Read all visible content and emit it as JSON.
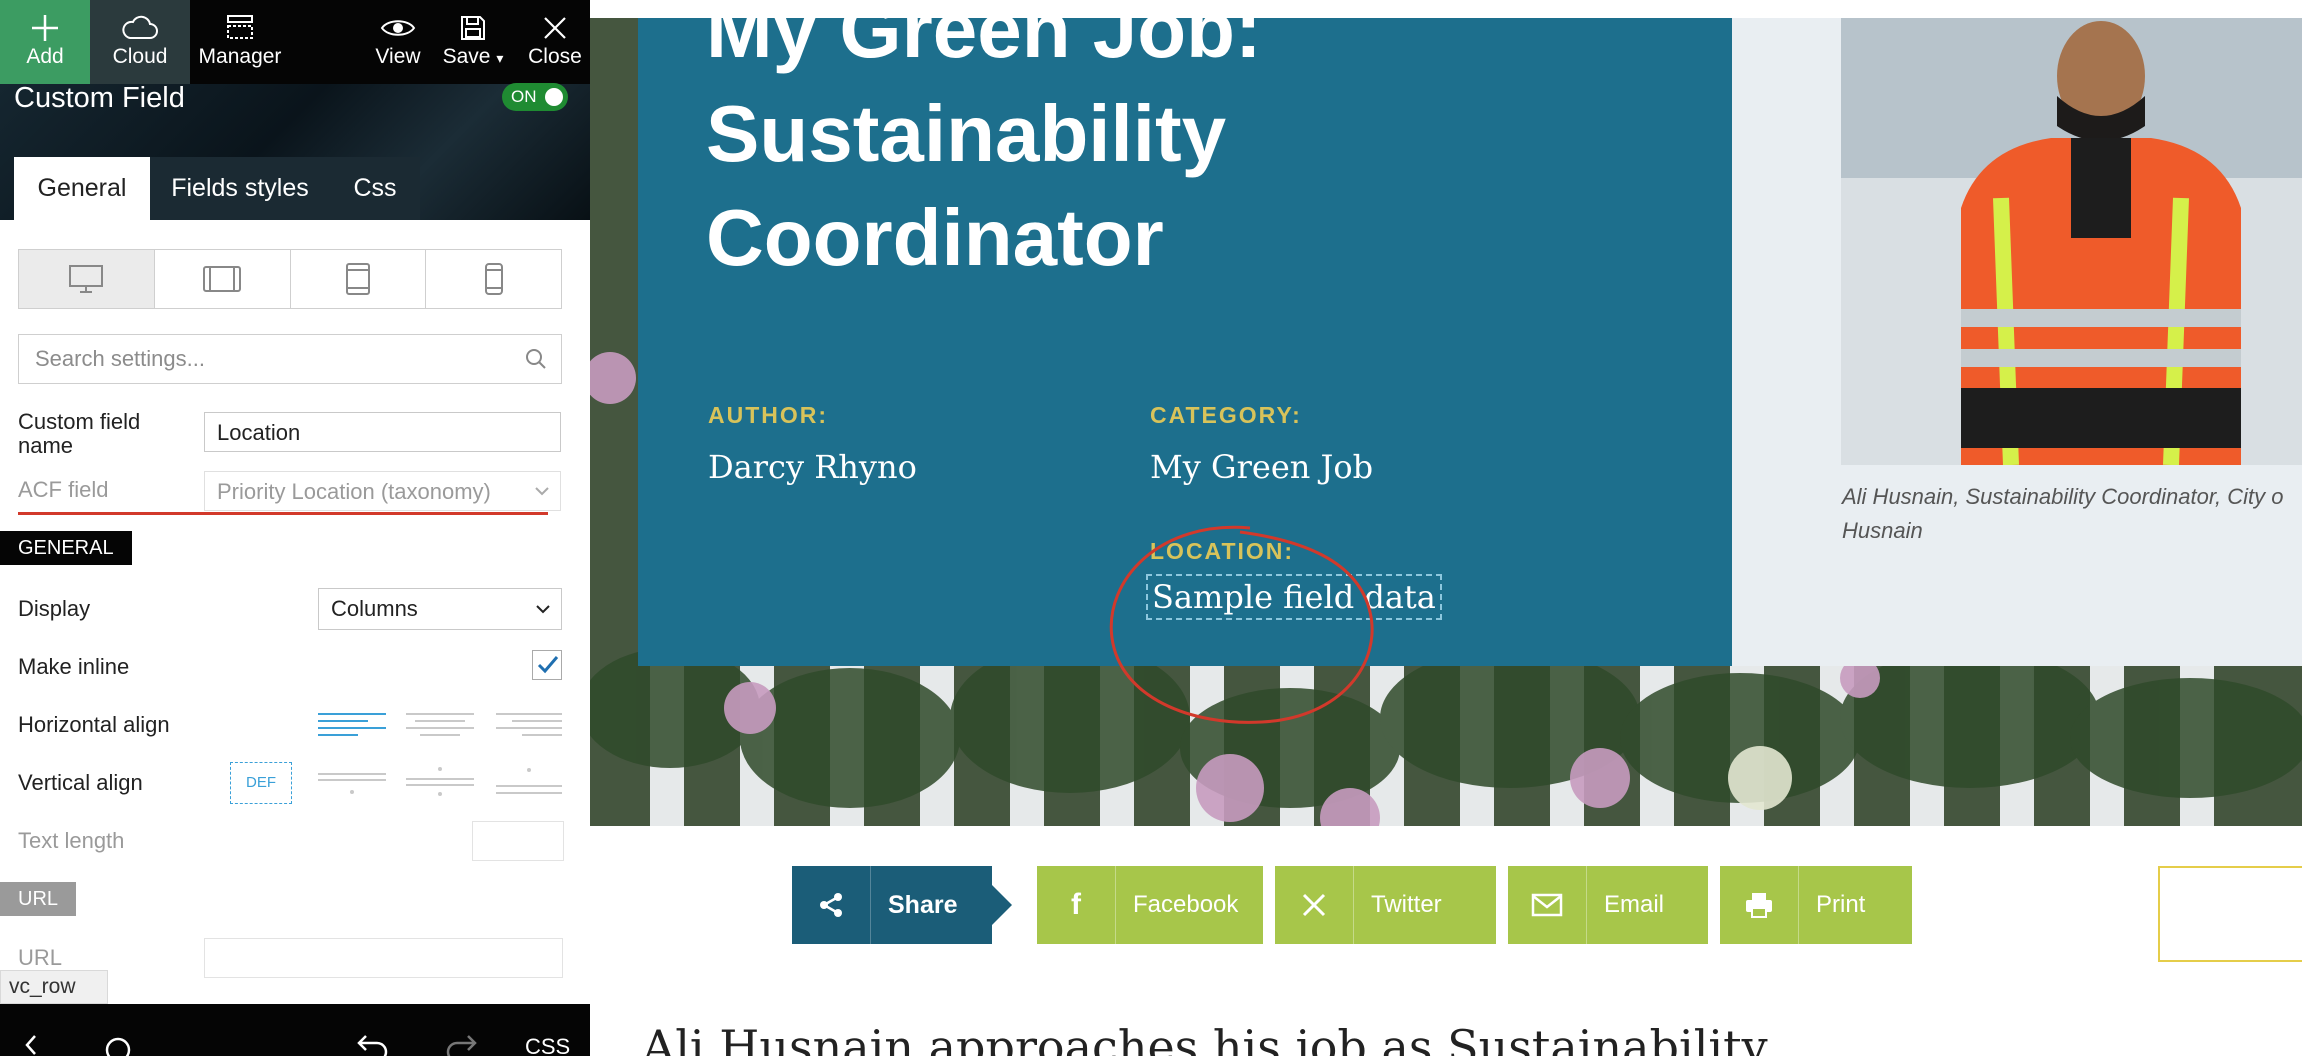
{
  "toolbar": {
    "add": "Add",
    "cloud": "Cloud",
    "manager": "Manager",
    "view": "View",
    "save": "Save",
    "close": "Close"
  },
  "panel": {
    "title": "Custom Field",
    "toggle": "ON",
    "tabs": [
      "General",
      "Fields styles",
      "Css"
    ],
    "search_placeholder": "Search settings...",
    "custom_field_name_label": "Custom field\nname",
    "custom_field_name_value": "Location",
    "acf_field_label": "ACF field",
    "acf_field_value": "Priority Location (taxonomy)",
    "general_section": "GENERAL",
    "display_label": "Display",
    "display_value": "Columns",
    "make_inline_label": "Make inline",
    "make_inline_checked": true,
    "horizontal_align_label": "Horizontal align",
    "vertical_align_label": "Vertical align",
    "vertical_align_default": "DEF",
    "text_length_label": "Text length",
    "url_section": "URL",
    "url_label": "URL",
    "breadcrumb": "vc_row",
    "bottom_css": "CSS"
  },
  "article": {
    "title_line1": "My Green Job:",
    "title_line2": "Sustainability",
    "title_line3": "Coordinator",
    "author_label": "AUTHOR:",
    "author_value": "Darcy Rhyno",
    "category_label": "CATEGORY:",
    "category_value": "My Green Job",
    "location_label": "LOCATION:",
    "location_value": "Sample field data",
    "photo_caption_line1": "Ali Husnain, Sustainability Coordinator, City o",
    "photo_caption_line2": "Husnain",
    "share": {
      "share": "Share",
      "facebook": "Facebook",
      "twitter": "Twitter",
      "email": "Email",
      "print": "Print"
    },
    "body_start": "Ali Husnain approaches his job as Sustainability"
  },
  "colors": {
    "accent_green": "#3c9c62",
    "hero_blue": "#1d6f8d",
    "meta_gold": "#d8c35a",
    "share_green": "#a7c64a",
    "share_dark": "#1b5d78",
    "annotation_red": "#d2392b"
  },
  "icons": {
    "add": "plus-icon",
    "cloud": "cloud-icon",
    "manager": "manager-icon",
    "view": "eye-icon",
    "save": "floppy-icon",
    "close": "close-icon"
  }
}
